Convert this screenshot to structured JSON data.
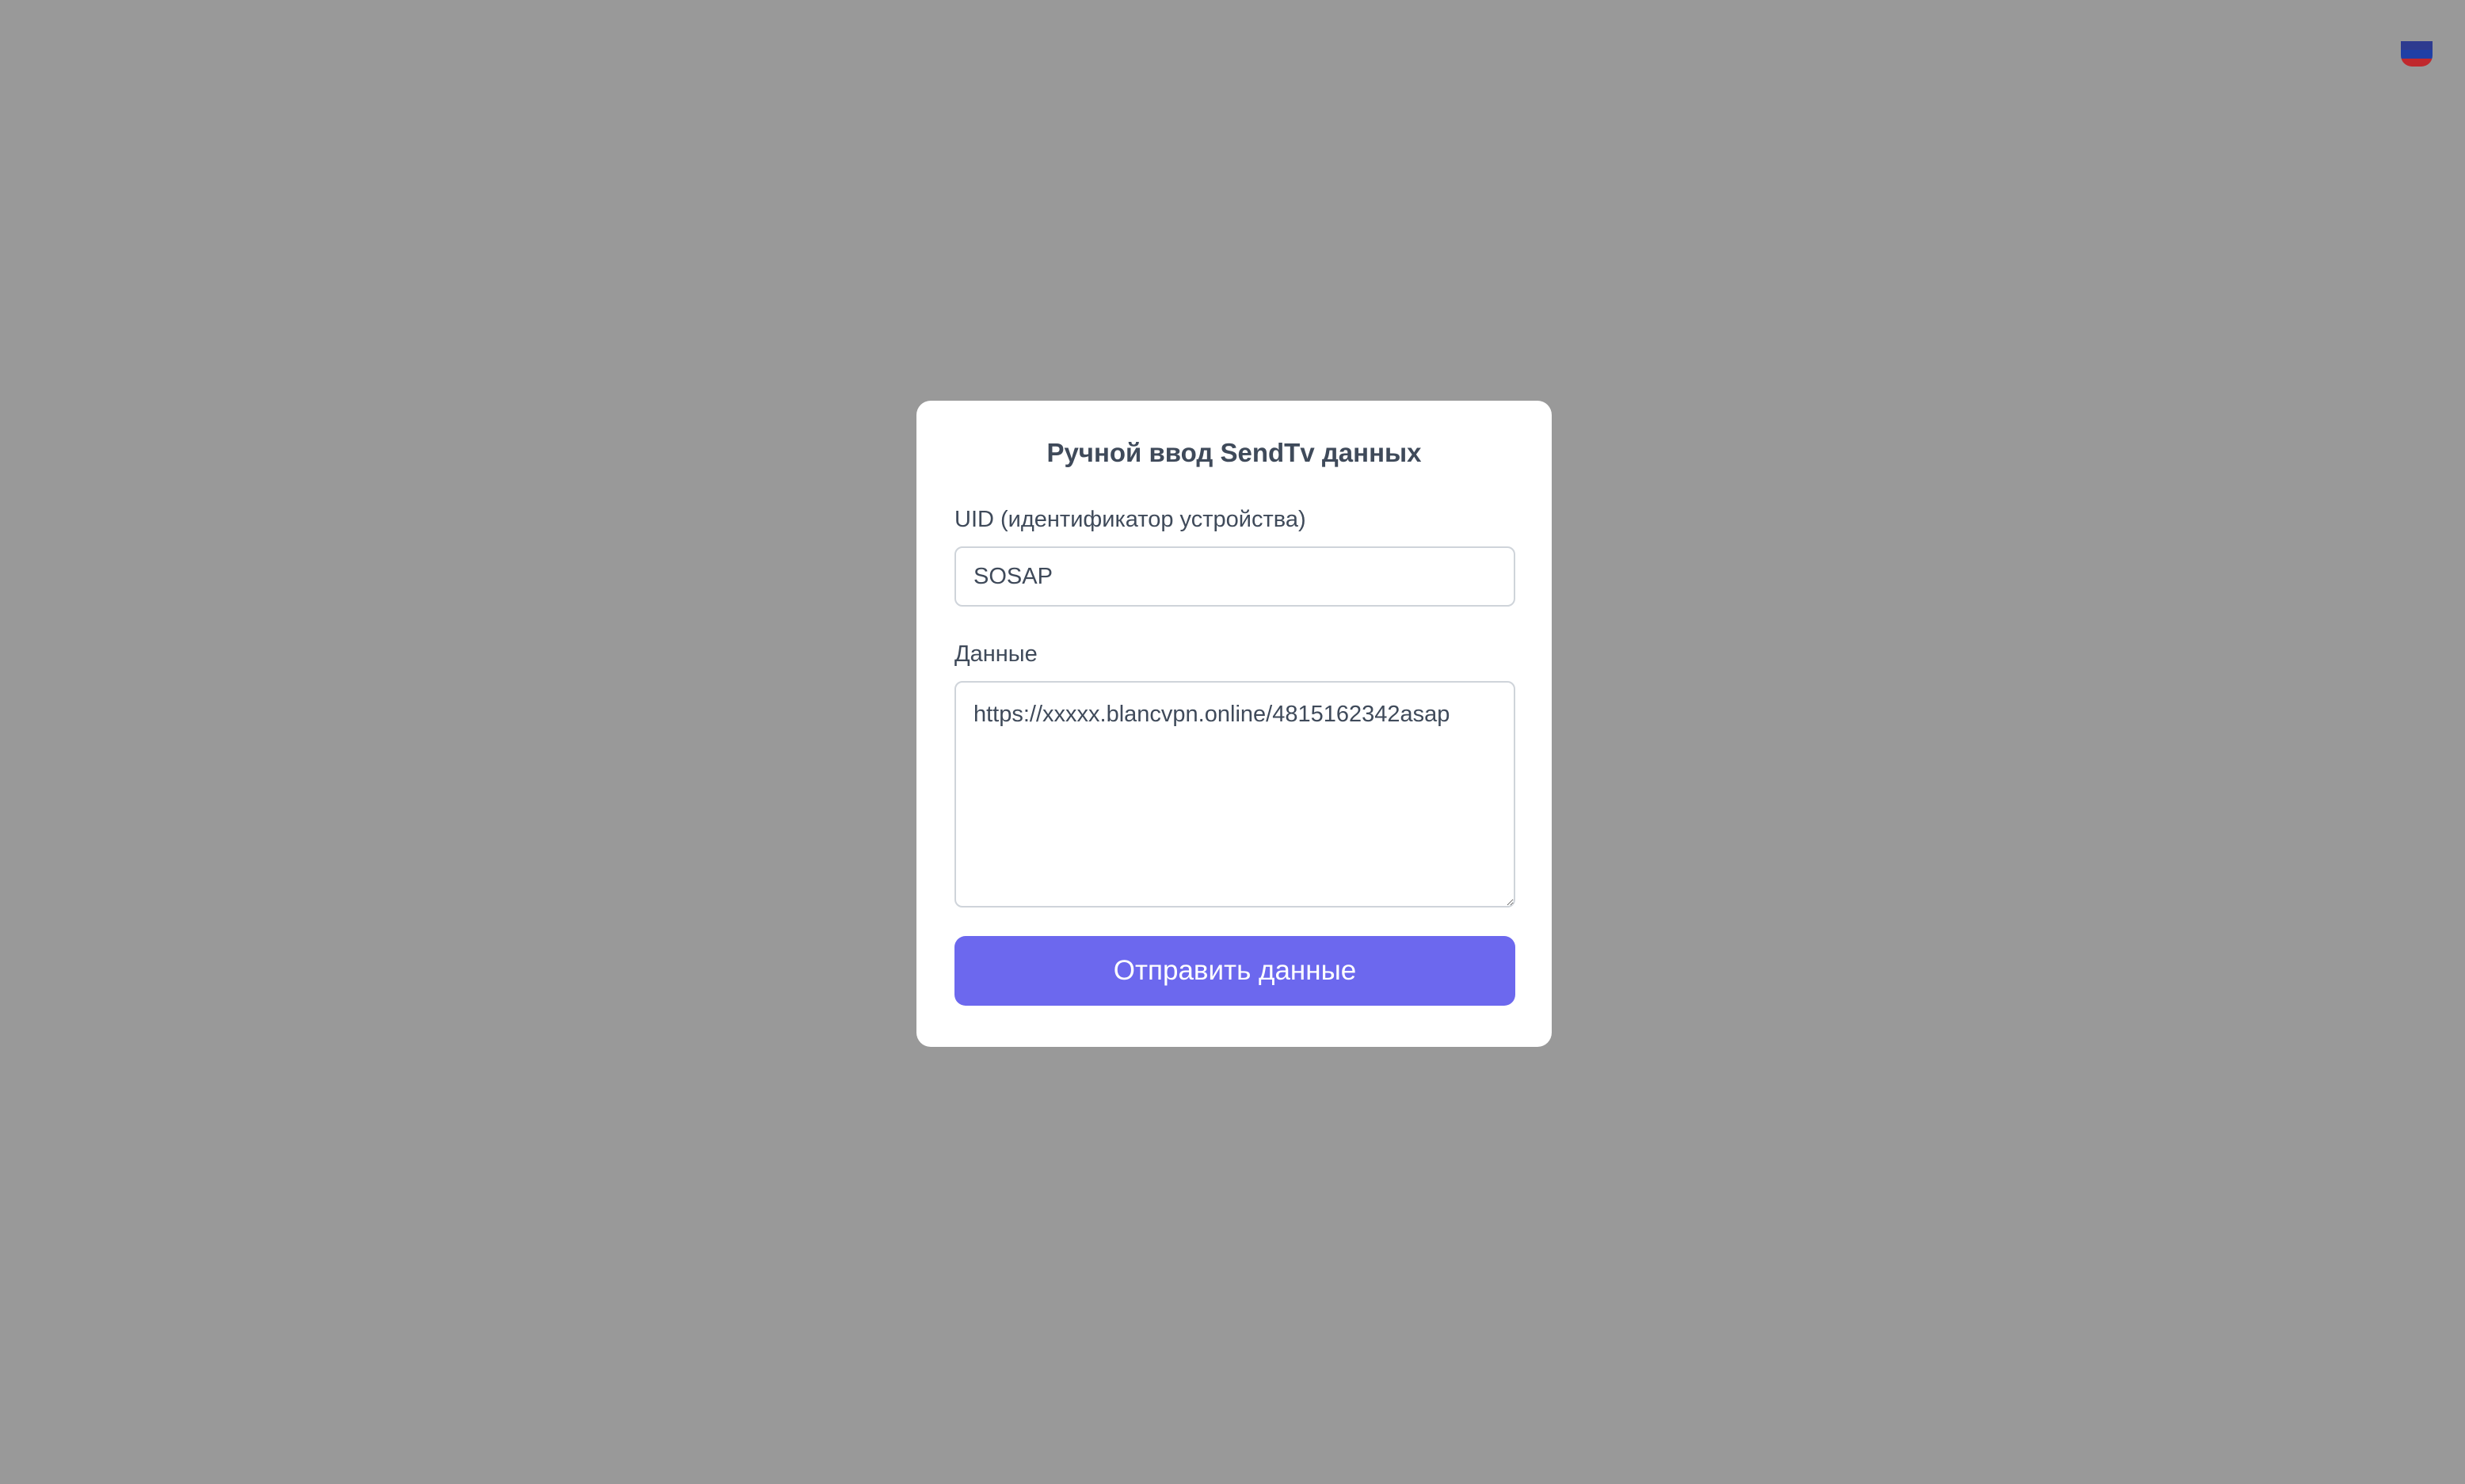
{
  "header": {
    "language_icon": "russia-flag-icon",
    "flag_colors": [
      "#ffffff",
      "#1f3fa6",
      "#d52b1e"
    ]
  },
  "modal": {
    "title": "Ручной ввод SendTv данных",
    "uid_label": "UID (идентификатор устройства)",
    "uid_value": "SOSAP",
    "data_label": "Данные",
    "data_value": "https://xxxxx.blancvpn.online/4815162342asap",
    "submit_label": "Отправить данные"
  },
  "colors": {
    "overlay": "#999999",
    "accent": "#6c68ee",
    "text": "#3f4a5a"
  }
}
